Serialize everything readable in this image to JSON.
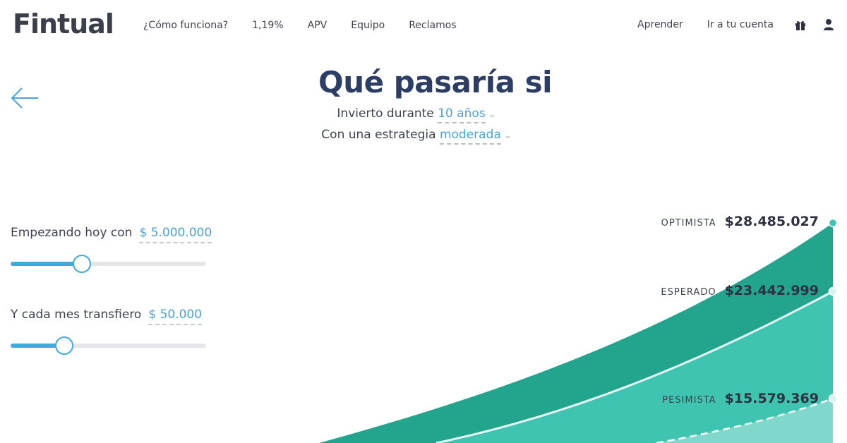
{
  "nav": {
    "logo": "Fintual",
    "left_links": [
      "¿Cómo funciona?",
      "1,19%",
      "APV",
      "Equipo",
      "Reclamos"
    ],
    "right_links": [
      "Aprender",
      "Ir a tu cuenta"
    ],
    "icons": [
      "gift-icon",
      "user-icon"
    ]
  },
  "header": {
    "title": "Qué pasaría si",
    "line1_prefix": "Invierto durante",
    "line1_value": "10 años",
    "line2_prefix": "Con una estrategia",
    "line2_value": "moderada"
  },
  "controls": {
    "initial_label": "Empezando hoy con",
    "initial_value": "$ 5.000.000",
    "initial_position": 0.36,
    "monthly_label": "Y cada mes transfiero",
    "monthly_value": "$ 50.000",
    "monthly_position": 0.27
  },
  "scenarios": {
    "optimista": {
      "name": "OPTIMISTA",
      "amount": "$28.485.027"
    },
    "esperado": {
      "name": "ESPERADO",
      "amount": "$23.442.999"
    },
    "pesimista": {
      "name": "PESIMISTA",
      "amount": "$15.579.369"
    }
  },
  "colors": {
    "brand_dark": "#2c3e66",
    "accent_blue": "#4aa3d9",
    "optimista_fill": "#22a58c",
    "esperado_fill": "#3ec4b0",
    "pesimista_fill": "#7fd8cb"
  }
}
